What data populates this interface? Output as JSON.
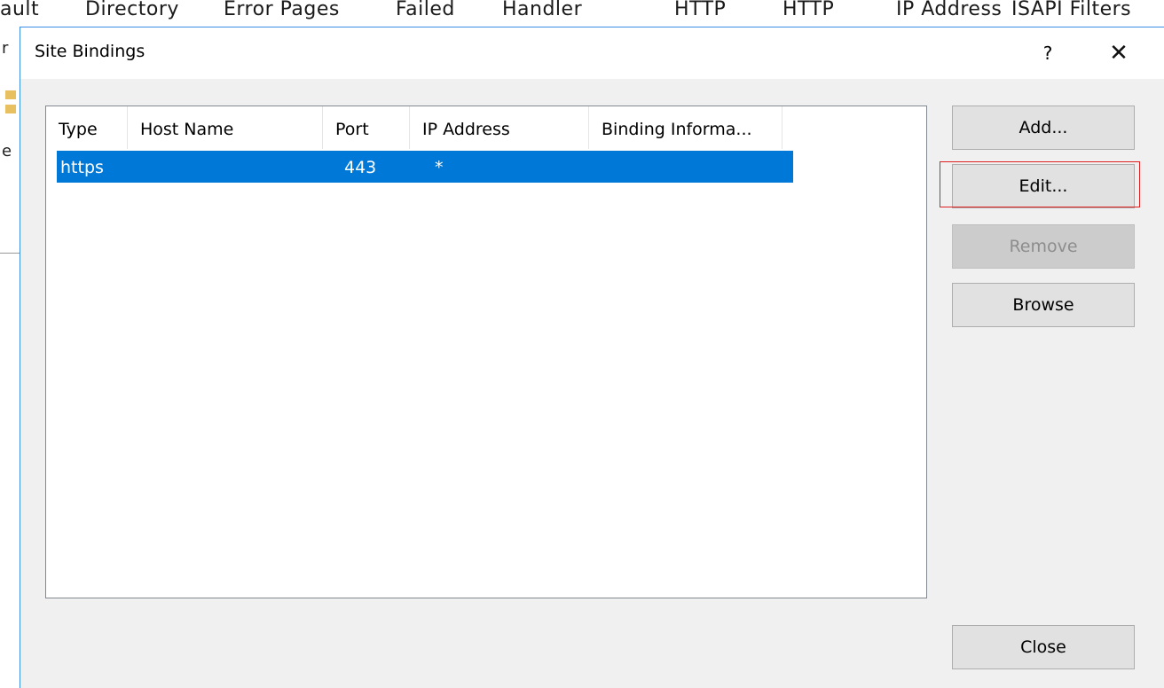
{
  "background": {
    "features": [
      "ault",
      "Directory",
      "Error Pages",
      "Failed",
      "Handler",
      "HTTP",
      "HTTP",
      "IP Address",
      "ISAPI Filters"
    ],
    "left_chars": [
      "r",
      "e"
    ]
  },
  "dialog": {
    "title": "Site Bindings",
    "help_label": "?",
    "close_glyph": "✕"
  },
  "table": {
    "columns": [
      "Type",
      "Host Name",
      "Port",
      "IP Address",
      "Binding Informa..."
    ],
    "rows": [
      {
        "type": "https",
        "host_name": "",
        "port": "443",
        "ip_address": "*",
        "binding_info": "",
        "selected": true
      }
    ]
  },
  "buttons": {
    "add": "Add...",
    "edit": "Edit...",
    "remove": "Remove",
    "browse": "Browse",
    "close": "Close"
  },
  "colors": {
    "selection": "#0078d7",
    "highlight_box": "#e02020",
    "dialog_bg": "#f0f0f0"
  }
}
